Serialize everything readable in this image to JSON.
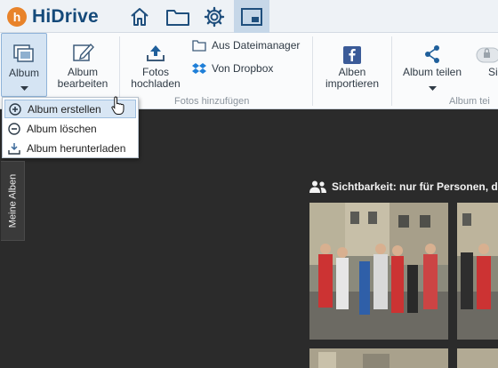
{
  "app": {
    "logo_text": "HiDrive",
    "logo_letter": "h"
  },
  "nav": [
    {
      "name": "home-icon"
    },
    {
      "name": "folder-icon"
    },
    {
      "name": "gear-icon"
    },
    {
      "name": "photo-icon"
    }
  ],
  "ribbon": {
    "album": "Album",
    "album_bearbeiten_1": "Album",
    "album_bearbeiten_2": "bearbeiten",
    "fotos_hochladen_1": "Fotos",
    "fotos_hochladen_2": "hochladen",
    "aus_dateimanager": "Aus Dateimanager",
    "von_dropbox": "Von Dropbox",
    "group_fotos_hinzufuegen": "Fotos hinzufügen",
    "alben_importieren_1": "Alben",
    "alben_importieren_2": "importieren",
    "album_teilen": "Album teilen",
    "group_album_teilen": "Album tei",
    "cut_button": "Si"
  },
  "dropdown": {
    "items": [
      {
        "label": "Album erstellen",
        "icon": "plus-circle-icon"
      },
      {
        "label": "Album löschen",
        "icon": "minus-circle-icon"
      },
      {
        "label": "Album herunterladen",
        "icon": "download-icon"
      }
    ]
  },
  "sidebar": {
    "tab_label": "Meine Alben"
  },
  "album": {
    "visibility_text": "Sichtbarkeit: nur für Personen, d"
  },
  "colors": {
    "accent": "#154a7a",
    "logo": "#e8832a",
    "background": "#2b2b2b",
    "selection": "#d5e4f3"
  }
}
